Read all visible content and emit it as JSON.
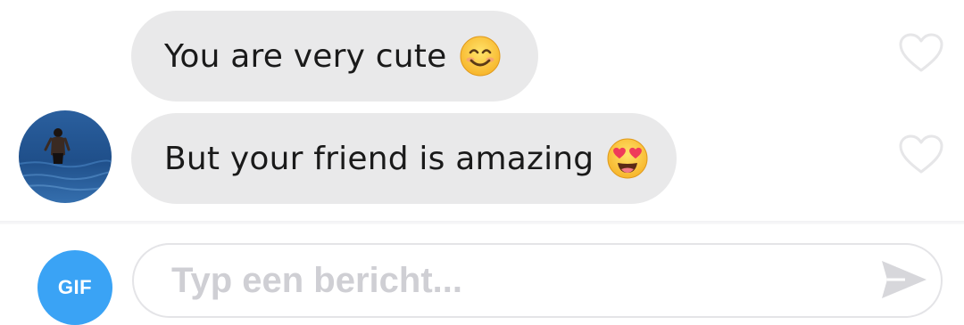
{
  "messages": [
    {
      "text": "You are very cute",
      "emoji": "smiling-face-icon",
      "liked": false
    },
    {
      "text": "But your friend is amazing",
      "emoji": "heart-eyes-face-icon",
      "liked": false
    }
  ],
  "composer": {
    "gif_label": "GIF",
    "placeholder": "Typ een bericht..."
  },
  "colors": {
    "bubble": "#e9e9ea",
    "gif_button": "#3aa3f5",
    "placeholder": "#cfcfd4",
    "heart_outline": "#e6e6e8",
    "send_icon": "#d7d7db"
  }
}
